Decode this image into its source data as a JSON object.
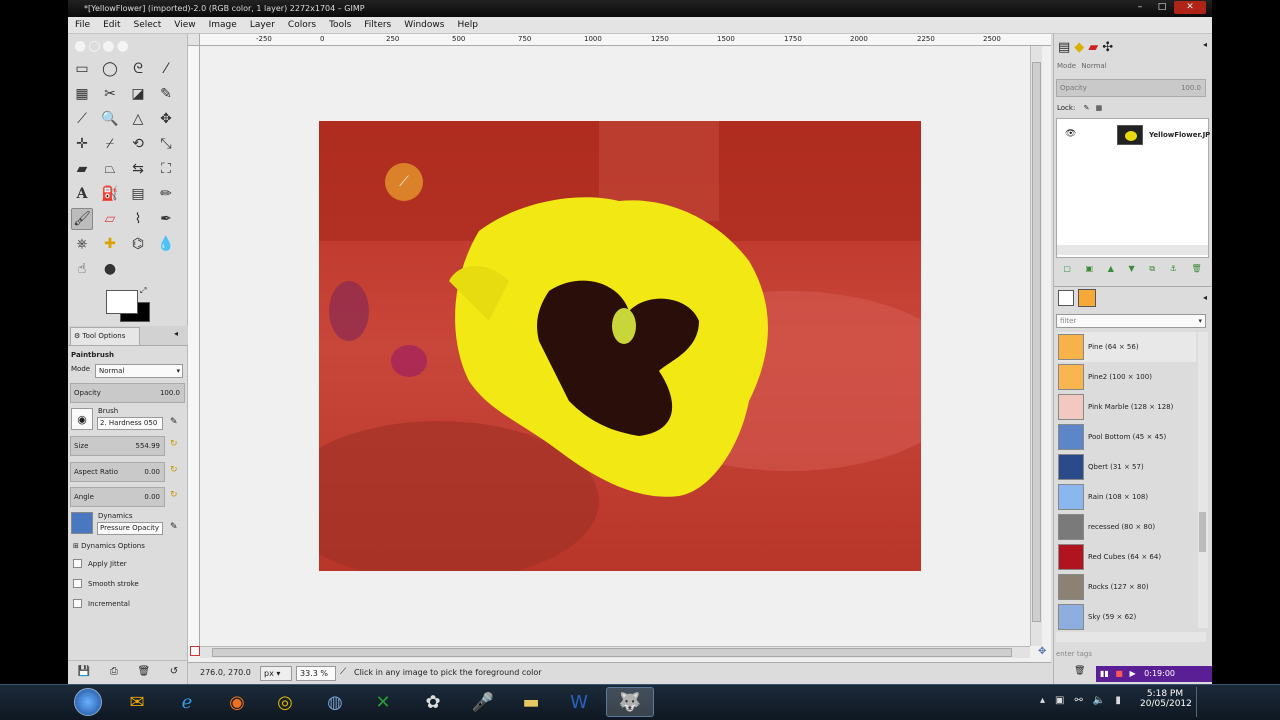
{
  "window": {
    "title": "*[YellowFlower] (imported)-2.0 (RGB color, 1 layer) 2272x1704 – GIMP"
  },
  "menu": [
    "File",
    "Edit",
    "Select",
    "View",
    "Image",
    "Layer",
    "Colors",
    "Tools",
    "Filters",
    "Windows",
    "Help"
  ],
  "toolbox": {
    "tool_options_tab": "Tool Options",
    "tool_name": "Paintbrush",
    "mode_label": "Mode",
    "mode_value": "Normal",
    "opacity_label": "Opacity",
    "opacity_value": "100.0",
    "brush_label": "Brush",
    "brush_value": "2. Hardness 050",
    "size_label": "Size",
    "size_value": "554.99",
    "aspect_label": "Aspect Ratio",
    "aspect_value": "0.00",
    "angle_label": "Angle",
    "angle_value": "0.00",
    "dynamics_label": "Dynamics",
    "dynamics_value": "Pressure Opacity",
    "dynamics_options": "Dynamics Options",
    "apply_jitter": "Apply Jitter",
    "smooth_stroke": "Smooth stroke",
    "incremental": "Incremental"
  },
  "ruler": {
    "h_ticks": [
      "-250",
      "0",
      "250",
      "500",
      "750",
      "1000",
      "1250",
      "1500",
      "1750",
      "2000",
      "2250",
      "2500"
    ]
  },
  "layers": {
    "mode_label": "Mode",
    "mode_value": "Normal",
    "opacity_label": "Opacity",
    "opacity_value": "100.0",
    "lock_label": "Lock:",
    "layer_name": "YellowFlower.JP"
  },
  "brushes": {
    "filter_placeholder": "filter",
    "tags_placeholder": "enter tags",
    "items": [
      {
        "label": "Pine (64 × 56)",
        "color": "#f7b24a"
      },
      {
        "label": "Pine2 (100 × 100)",
        "color": "#f8b550"
      },
      {
        "label": "Pink Marble (128 × 128)",
        "color": "#f1c9c0"
      },
      {
        "label": "Pool Bottom (45 × 45)",
        "color": "#5d86c8"
      },
      {
        "label": "Qbert (31 × 57)",
        "color": "#2a4a8a"
      },
      {
        "label": "Rain (108 × 108)",
        "color": "#8ab8ee"
      },
      {
        "label": "recessed (80 × 80)",
        "color": "#7a7a7a"
      },
      {
        "label": "Red Cubes (64 × 64)",
        "color": "#b0141e"
      },
      {
        "label": "Rocks (127 × 80)",
        "color": "#8c8274"
      },
      {
        "label": "Sky (59 × 62)",
        "color": "#8eaee0"
      }
    ]
  },
  "status": {
    "coords": "276.0, 270.0",
    "unit": "px",
    "zoom": "33.3 %",
    "message": "Click in any image to pick the foreground color"
  },
  "recorder": {
    "time": "0:19:00"
  },
  "clock": {
    "time": "5:18 PM",
    "date": "20/05/2012"
  }
}
